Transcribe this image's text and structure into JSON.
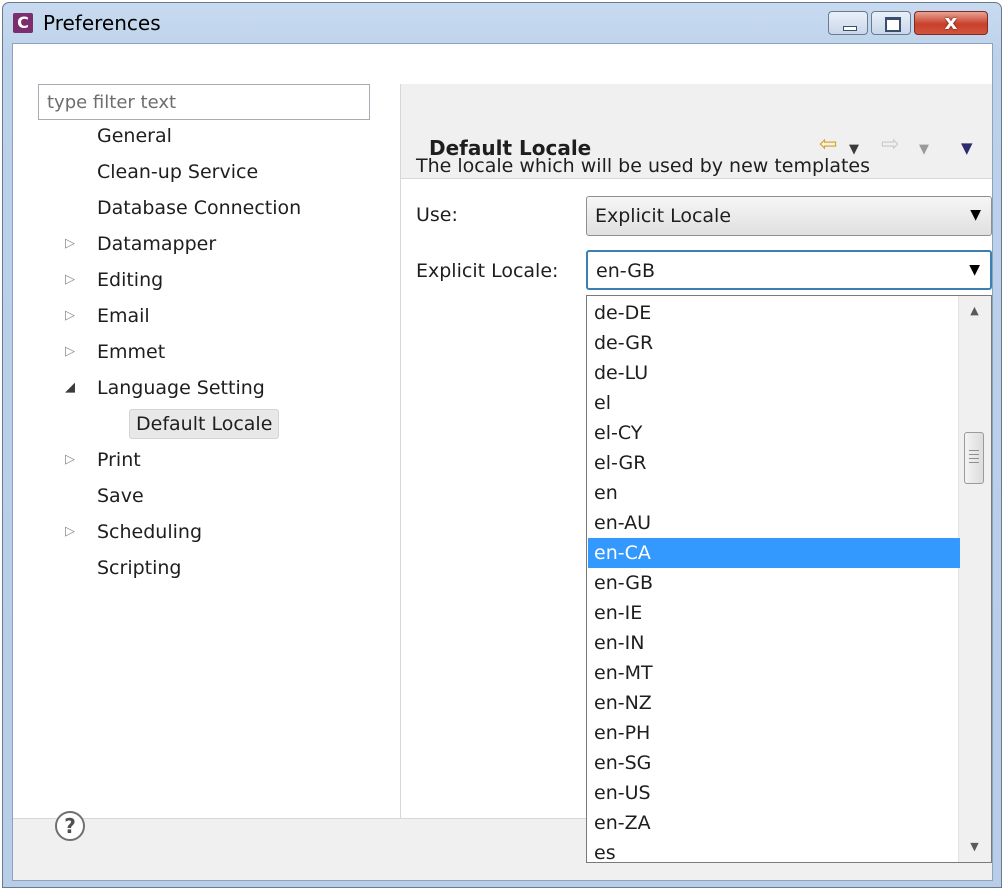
{
  "window": {
    "app_icon": "C",
    "title": "Preferences",
    "minimize_icon": "minimize-icon",
    "maximize_icon": "maximize-icon",
    "close_label": "x"
  },
  "filter": {
    "placeholder": "type filter text",
    "value": ""
  },
  "tree": [
    {
      "label": "General",
      "expander": ""
    },
    {
      "label": "Clean-up Service",
      "expander": ""
    },
    {
      "label": "Database Connection",
      "expander": ""
    },
    {
      "label": "Datamapper",
      "expander": "▷"
    },
    {
      "label": "Editing",
      "expander": "▷"
    },
    {
      "label": "Email",
      "expander": "▷"
    },
    {
      "label": "Emmet",
      "expander": "▷"
    },
    {
      "label": "Language Setting",
      "expander": "◢"
    },
    {
      "label": "Default Locale",
      "expander": "",
      "child": true,
      "selected": true
    },
    {
      "label": "Print",
      "expander": "▷"
    },
    {
      "label": "Save",
      "expander": ""
    },
    {
      "label": "Scheduling",
      "expander": "▷"
    },
    {
      "label": "Scripting",
      "expander": ""
    }
  ],
  "page": {
    "title": "Default Locale",
    "description": "The locale which will be used by new templates",
    "use_label": "Use:",
    "use_value": "Explicit Locale",
    "explicit_label": "Explicit Locale:",
    "explicit_value": "en-GB"
  },
  "nav": {
    "back_icon": "⇦",
    "back_drop": "▼",
    "forward_icon": "⇨",
    "forward_drop": "▼",
    "menu": "▼"
  },
  "combo_arrow": "▼",
  "dropdown": {
    "options": [
      "de-DE",
      "de-GR",
      "de-LU",
      "el",
      "el-CY",
      "el-GR",
      "en",
      "en-AU",
      "en-CA",
      "en-GB",
      "en-IE",
      "en-IN",
      "en-MT",
      "en-NZ",
      "en-PH",
      "en-SG",
      "en-US",
      "en-ZA",
      "es"
    ],
    "highlighted": "en-CA",
    "scroll_up": "▲",
    "scroll_down": "▼"
  },
  "help": {
    "label": "?"
  }
}
